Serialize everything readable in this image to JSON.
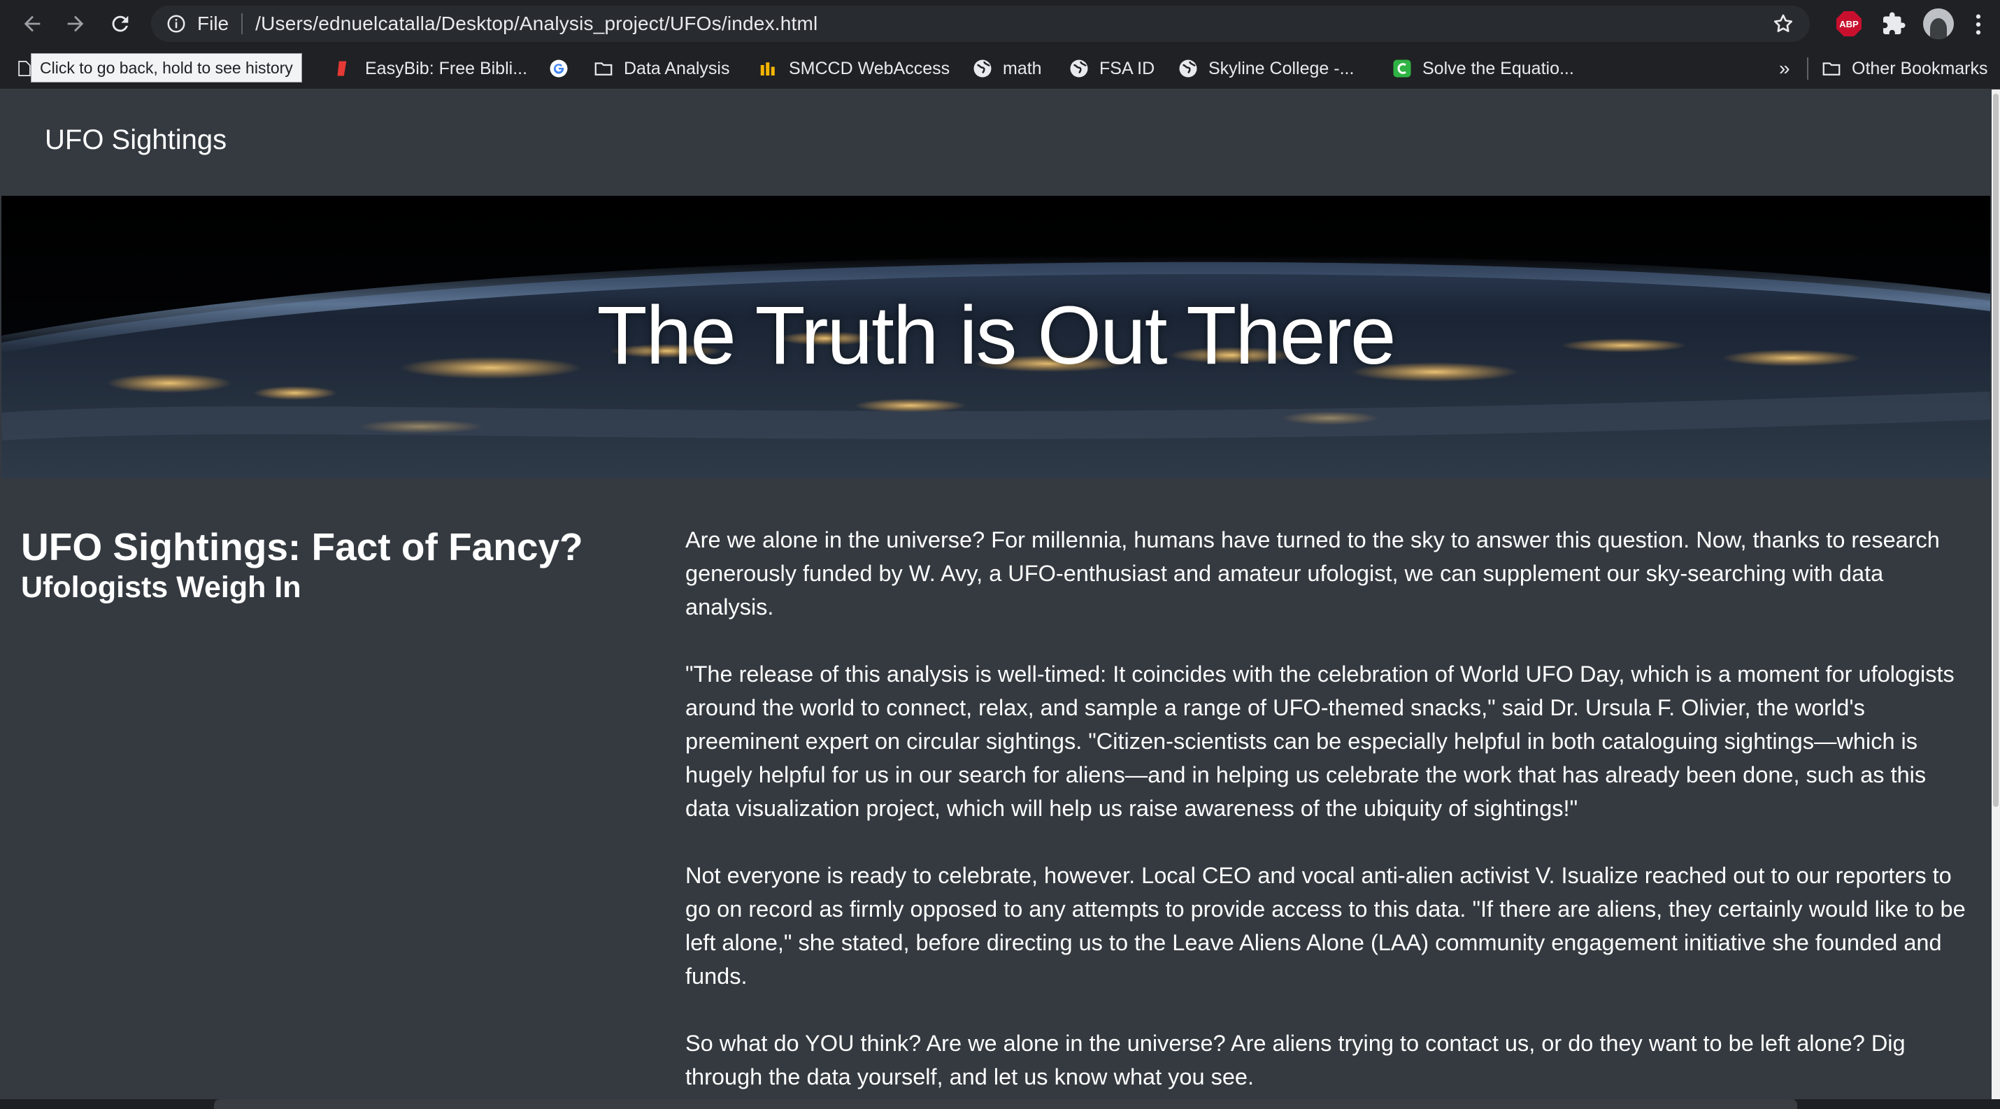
{
  "browser": {
    "scheme_label": "File",
    "url": "/Users/ednuelcatalla/Desktop/Analysis_project/UFOs/index.html",
    "tooltip": "Click to go back, hold to see history",
    "extensions": [
      "adblock-plus-icon",
      "puzzle-icon"
    ],
    "abp_label": "ABP",
    "overflow_chevron": "»",
    "bookmarks": [
      {
        "label": "EasyBib: Free Bibli...",
        "icon": "easybib-icon"
      },
      {
        "label": "",
        "icon": "google-icon"
      },
      {
        "label": "Data Analysis",
        "icon": "folder-icon"
      },
      {
        "label": "SMCCD WebAccess",
        "icon": "smccd-icon"
      },
      {
        "label": "math",
        "icon": "globe-icon"
      },
      {
        "label": "FSA ID",
        "icon": "globe-icon"
      },
      {
        "label": "Skyline College -...",
        "icon": "globe-icon"
      },
      {
        "label": "Solve the Equatio...",
        "icon": "mathway-icon"
      }
    ],
    "other_bookmarks": "Other Bookmarks"
  },
  "navbar": {
    "brand": "UFO Sightings"
  },
  "hero": {
    "title": "The Truth is Out There"
  },
  "article": {
    "title": "UFO Sightings: Fact of Fancy?",
    "subtitle": "Ufologists Weigh In",
    "paragraphs": [
      "Are we alone in the universe? For millennia, humans have turned to the sky to answer this question. Now, thanks to research generously funded by W. Avy, a UFO-enthusiast and amateur ufologist, we can supplement our sky-searching with data analysis.",
      "\"The release of this analysis is well-timed: It coincides with the celebration of World UFO Day, which is a moment for ufologists around the world to connect, relax, and sample a range of UFO-themed snacks,\" said Dr. Ursula F. Olivier, the world's preeminent expert on circular sightings. \"Citizen-scientists can be especially helpful in both cataloguing sightings—which is hugely helpful for us in our search for aliens—and in helping us celebrate the work that has already been done, such as this data visualization project, which will help us raise awareness of the ubiquity of sightings!\"",
      "Not everyone is ready to celebrate, however. Local CEO and vocal anti-alien activist V. Isualize reached out to our reporters to go on record as firmly opposed to any attempts to provide access to this data. \"If there are aliens, they certainly would like to be left alone,\" she stated, before directing us to the Leave Aliens Alone (LAA) community engagement initiative she founded and funds.",
      "So what do YOU think? Are we alone in the universe? Are aliens trying to contact us, or do they want to be left alone? Dig through the data yourself, and let us know what you see."
    ]
  },
  "colors": {
    "page_bg": "#343a40",
    "chrome_bg": "#202124",
    "omnibox_bg": "#282b2f",
    "text": "#ffffff"
  }
}
